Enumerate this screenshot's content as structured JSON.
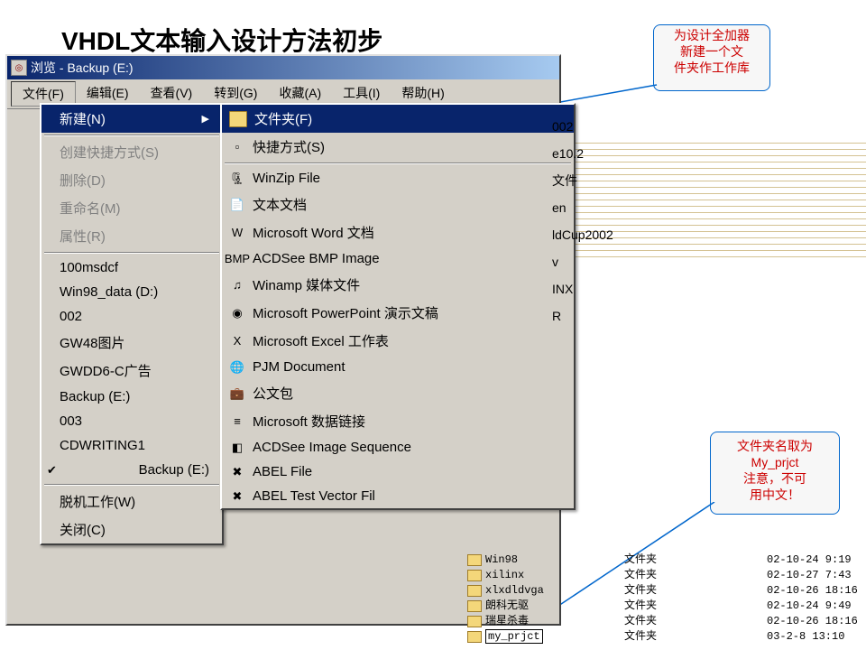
{
  "title": "VHDL文本输入设计方法初步",
  "callout1": "为设计全加器\n新建一个文\n件夹作工作库",
  "callout2_a": "文件夹名取为",
  "callout2_b": "My_prjct",
  "callout2_c": "注意，不可",
  "callout2_d": "用中文！",
  "window": {
    "title": "浏览 - Backup (E:)"
  },
  "menubar": [
    "文件(F)",
    "编辑(E)",
    "查看(V)",
    "转到(G)",
    "收藏(A)",
    "工具(I)",
    "帮助(H)"
  ],
  "menu1": {
    "new": "新建(N)",
    "shortcut": "创建快捷方式(S)",
    "delete": "删除(D)",
    "rename": "重命名(M)",
    "properties": "属性(R)",
    "items2": [
      "100msdcf",
      "Win98_data (D:)",
      "002",
      "GW48图片",
      "GWDD6-C广告",
      "Backup (E:)",
      "003",
      "CDWRITING1",
      "Backup (E:)"
    ],
    "offline": "脱机工作(W)",
    "close": "关闭(C)"
  },
  "menu2": [
    {
      "icon": "folder",
      "label": "文件夹(F)",
      "hl": true
    },
    {
      "icon": "shortcut",
      "label": "快捷方式(S)"
    },
    {
      "sep": true
    },
    {
      "icon": "winzip",
      "label": "WinZip File"
    },
    {
      "icon": "text",
      "label": "文本文档"
    },
    {
      "icon": "word",
      "label": "Microsoft Word 文档"
    },
    {
      "icon": "bmp",
      "label": "ACDSee BMP Image"
    },
    {
      "icon": "winamp",
      "label": "Winamp 媒体文件"
    },
    {
      "icon": "ppt",
      "label": "Microsoft PowerPoint 演示文稿"
    },
    {
      "icon": "excel",
      "label": "Microsoft Excel 工作表"
    },
    {
      "icon": "pjm",
      "label": "PJM Document"
    },
    {
      "icon": "briefcase",
      "label": "公文包"
    },
    {
      "icon": "mdb",
      "label": "Microsoft 数据链接"
    },
    {
      "icon": "acd",
      "label": "ACDSee Image Sequence"
    },
    {
      "icon": "abel",
      "label": "ABEL File"
    },
    {
      "icon": "abel",
      "label": "ABEL Test Vector Fil"
    }
  ],
  "bg_items": [
    "002",
    "e10.2",
    "",
    "文件",
    "en",
    "ldCup2002",
    "v",
    "",
    "INX",
    "R"
  ],
  "folders": [
    {
      "name": "Win98",
      "type": "文件夹",
      "date": "02-10-24 9:19"
    },
    {
      "name": "xilinx",
      "type": "文件夹",
      "date": "02-10-27 7:43"
    },
    {
      "name": "xlxdldvga",
      "type": "文件夹",
      "date": "02-10-26 18:16"
    },
    {
      "name": "朗科无驱",
      "type": "文件夹",
      "date": "02-10-24 9:49"
    },
    {
      "name": "瑞星杀毒",
      "type": "文件夹",
      "date": "02-10-26 18:16"
    },
    {
      "name": "my_prjct",
      "type": "文件夹",
      "date": "03-2-8 13:10",
      "edit": true
    }
  ]
}
